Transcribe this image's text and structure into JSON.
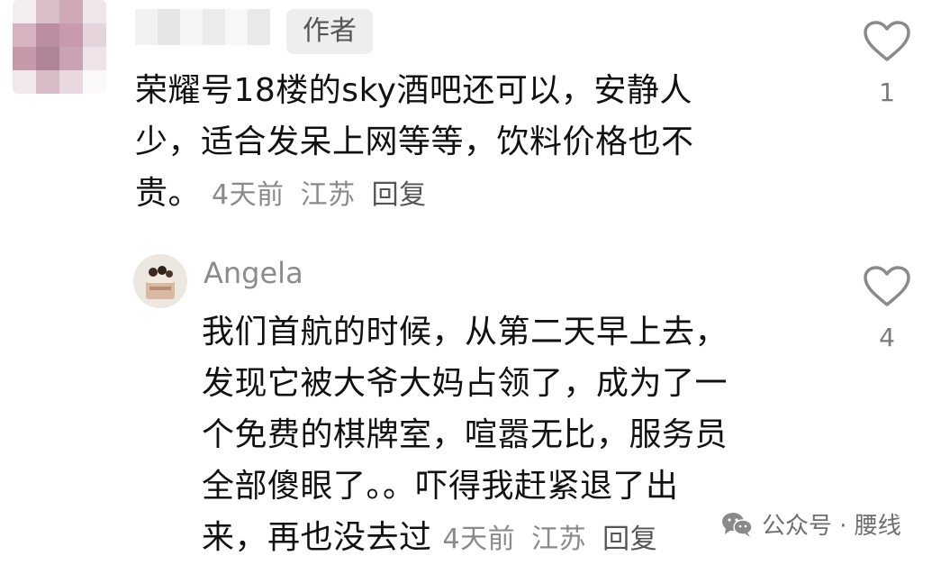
{
  "comment": {
    "badge": "作者",
    "lines": [
      "荣耀号18楼的sky酒吧还可以，安静人",
      "少，适合发呆上网等等，饮料价格也不",
      "贵。"
    ],
    "time": "4天前",
    "location": "江苏",
    "reply_label": "回复",
    "like_count": "1"
  },
  "reply": {
    "author": "Angela",
    "lines": [
      "我们首航的时候，从第二天早上去，",
      "发现它被大爷大妈占领了，成为了一",
      "个免费的棋牌室，喧嚣无比，服务员",
      "全部傻眼了。。吓得我赶紧退了出",
      "来，再也没去过"
    ],
    "time": "4天前",
    "location": "江苏",
    "reply_label": "回复",
    "like_count": "4"
  },
  "watermark": {
    "text": "公众号 · 腰线",
    "icon": "wechat-icon"
  }
}
